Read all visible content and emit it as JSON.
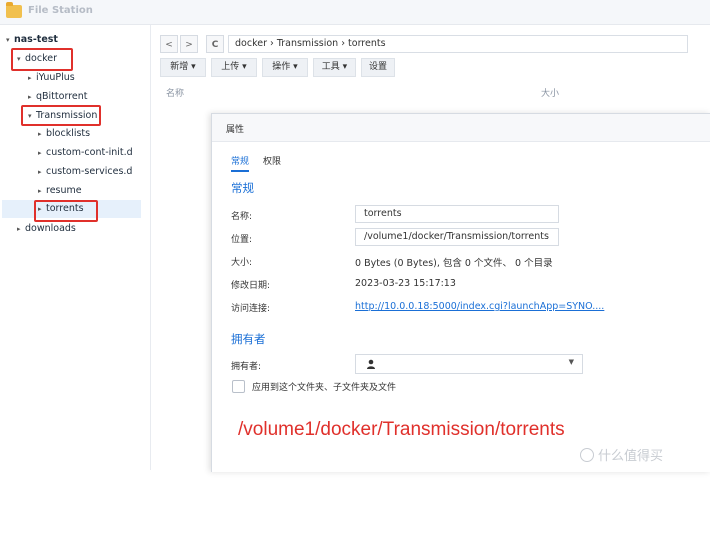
{
  "app": {
    "title": "File Station"
  },
  "sidebar": {
    "items": [
      {
        "label": "nas-test",
        "arrow": "▾"
      },
      {
        "label": "docker",
        "arrow": "▾"
      },
      {
        "label": "iYuuPlus",
        "arrow": "▸"
      },
      {
        "label": "qBittorrent",
        "arrow": "▸"
      },
      {
        "label": "Transmission",
        "arrow": "▾"
      },
      {
        "label": "blocklists",
        "arrow": "▸"
      },
      {
        "label": "custom-cont-init.d",
        "arrow": "▸"
      },
      {
        "label": "custom-services.d",
        "arrow": "▸"
      },
      {
        "label": "resume",
        "arrow": "▸"
      },
      {
        "label": "torrents",
        "arrow": "▸"
      },
      {
        "label": "downloads",
        "arrow": "▸"
      }
    ]
  },
  "toolbar": {
    "back": "<",
    "forward": ">",
    "refresh": "C",
    "path": "docker › Transmission › torrents",
    "actions": [
      "新增 ▾",
      "上传 ▾",
      "操作 ▾",
      "工具 ▾",
      "设置"
    ]
  },
  "list": {
    "col_name": "名称",
    "col_size": "大小"
  },
  "dialog": {
    "title": "属性",
    "tabs": [
      "常规",
      "权限"
    ],
    "general_section": "常规",
    "fields": {
      "name_label": "名称:",
      "name_value": "torrents",
      "location_label": "位置:",
      "location_value": "/volume1/docker/Transmission/torrents",
      "size_label": "大小:",
      "size_value": "0 Bytes (0 Bytes), 包含 0 个文件、 0 个目录",
      "modified_label": "修改日期:",
      "modified_value": "2023-03-23 15:17:13",
      "link_label": "访问连接:",
      "link_value": "http://10.0.0.18:5000/index.cgi?launchApp=SYNO...."
    },
    "owner_section": "拥有者",
    "owner_label": "拥有者:",
    "apply_label": "应用到这个文件夹、子文件夹及文件"
  },
  "annotation": "/volume1/docker/Transmission/torrents",
  "watermark": "什么值得买",
  "colors": {
    "accent": "#1a6fd6",
    "highlight": "#e0302b",
    "selected_bg": "#e6f0fb"
  }
}
